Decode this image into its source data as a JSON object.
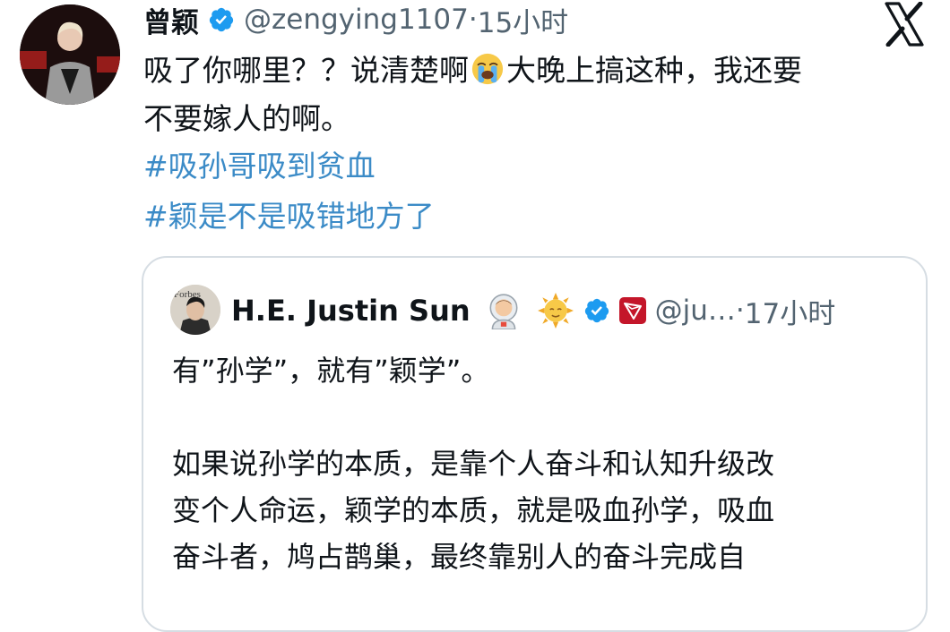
{
  "tweet": {
    "author_name": "曾颖",
    "handle": "@zengying1107",
    "separator": " · ",
    "time": "15小时",
    "text_line1_a": "吸了你哪里？？说清楚啊",
    "text_line1_b": "大晚上搞这种，我还要",
    "text_line2": "不要嫁人的啊。",
    "hashtags": [
      "#吸孙哥吸到贫血",
      "#颖是不是吸错地方了"
    ]
  },
  "quote": {
    "author_name": "H.E. Justin Sun",
    "handle": "@ju…",
    "separator": " · ",
    "time": "17小时",
    "lines": [
      "有”孙学”，就有”颖学”。",
      "如果说孙学的本质，是靠个人奋斗和认知升级改",
      "变个人命运，颖学的本质，就是吸血孙学，吸血",
      "奋斗者，鸠占鹊巢，最终靠别人的奋斗完成自"
    ]
  },
  "icons": {
    "platform": "x-logo-icon",
    "verified": "verified-badge-icon",
    "crying_emoji": "loudly-crying-face-icon",
    "astronaut_emoji": "astronaut-icon",
    "sun_emoji": "sun-with-face-icon",
    "tron": "tron-logo-icon"
  },
  "colors": {
    "hashtag": "#3b8bc7",
    "verified": "#1d9bf0",
    "tron": "#c4162a",
    "secondary_text": "#536471"
  }
}
